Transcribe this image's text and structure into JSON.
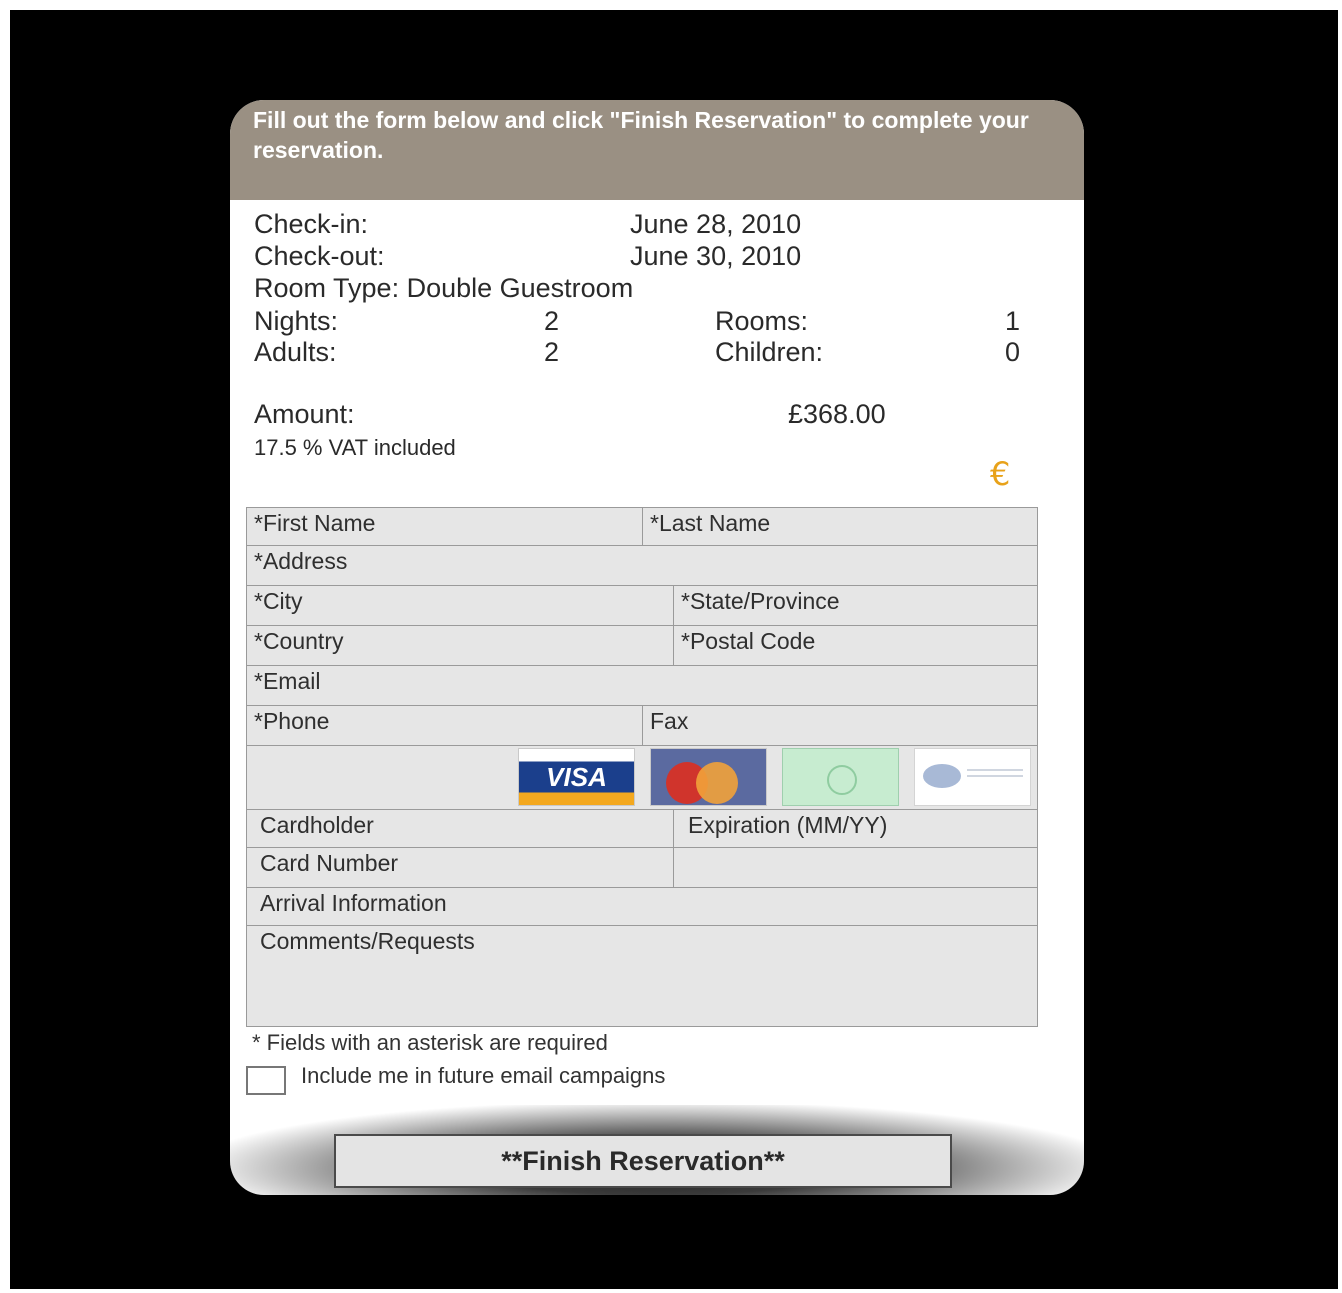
{
  "header": {
    "instruction": "Fill out the form below and click \"Finish Reservation\" to complete your reservation."
  },
  "summary": {
    "checkin_label": "Check-in:",
    "checkin_value": "June 28, 2010",
    "checkout_label": "Check-out:",
    "checkout_value": "June 30, 2010",
    "room_type": "Room Type: Double Guestroom",
    "nights_label": "Nights:",
    "nights_value": "2",
    "rooms_label": "Rooms:",
    "rooms_value": "1",
    "adults_label": "Adults:",
    "adults_value": "2",
    "children_label": "Children:",
    "children_value": "0",
    "amount_label": "Amount:",
    "amount_value": "£368.00",
    "vat_note": "17.5 % VAT included",
    "currency_icon": "euro-icon",
    "currency_symbol": "€"
  },
  "form": {
    "first_name": "*First Name",
    "last_name": "*Last Name",
    "address": "*Address",
    "city": "*City",
    "state": "*State/Province",
    "country": "*Country",
    "postal_code": "*Postal Code",
    "email": "*Email",
    "phone": "*Phone",
    "fax": "Fax",
    "card_logos": {
      "visa": "VISA",
      "mastercard_icon": "mastercard-logo"
    },
    "cardholder": "Cardholder",
    "expiration": "Expiration (MM/YY)",
    "card_number": "Card Number",
    "arrival_information": "Arrival Information",
    "comments": "Comments/Requests"
  },
  "footer": {
    "required_note": "* Fields with an asterisk are required",
    "campaign_label": "Include me in future email campaigns",
    "campaign_checked": false,
    "finish_button": "**Finish Reservation**"
  },
  "colors": {
    "header_bg": "#9a9083",
    "form_bg": "#e6e6e6",
    "euro_accent": "#e8a21a",
    "backdrop": "#000000"
  }
}
